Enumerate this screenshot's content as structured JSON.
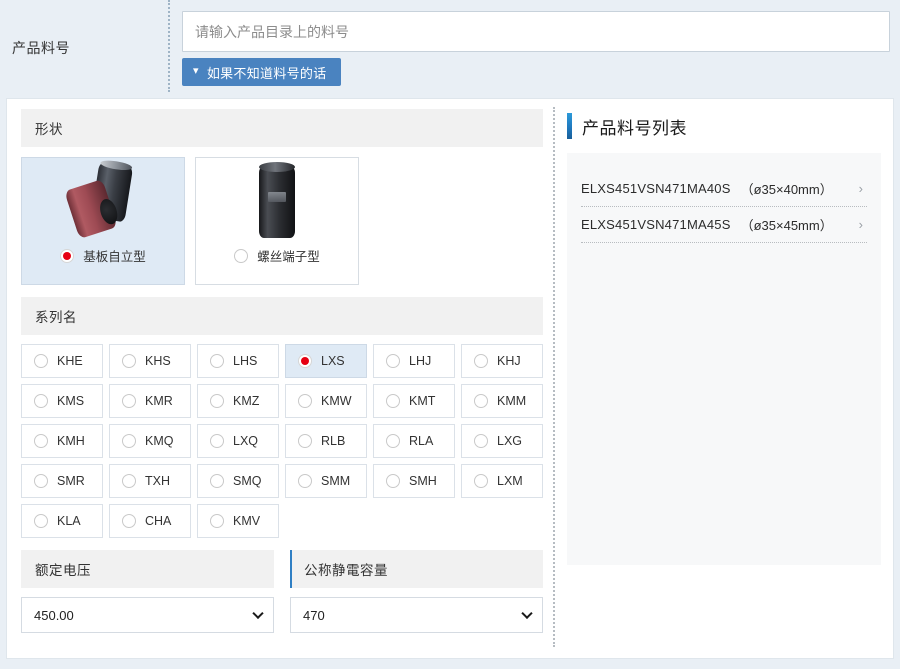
{
  "search": {
    "label": "产品料号",
    "placeholder": "请输入产品目录上的料号",
    "value": "",
    "hint_button": "如果不知道料号的话",
    "hint_chevron": "chevron-down-icon"
  },
  "shape": {
    "header": "形状",
    "options": [
      {
        "label": "基板自立型",
        "selected": true,
        "art": "snap-in-capacitor"
      },
      {
        "label": "螺丝端子型",
        "selected": false,
        "art": "screw-terminal-capacitor"
      }
    ]
  },
  "series": {
    "header": "系列名",
    "options": [
      {
        "label": "KHE",
        "selected": false
      },
      {
        "label": "KHS",
        "selected": false
      },
      {
        "label": "LHS",
        "selected": false
      },
      {
        "label": "LXS",
        "selected": true
      },
      {
        "label": "LHJ",
        "selected": false
      },
      {
        "label": "KHJ",
        "selected": false
      },
      {
        "label": "KMS",
        "selected": false
      },
      {
        "label": "KMR",
        "selected": false
      },
      {
        "label": "KMZ",
        "selected": false
      },
      {
        "label": "KMW",
        "selected": false
      },
      {
        "label": "KMT",
        "selected": false
      },
      {
        "label": "KMM",
        "selected": false
      },
      {
        "label": "KMH",
        "selected": false
      },
      {
        "label": "KMQ",
        "selected": false
      },
      {
        "label": "LXQ",
        "selected": false
      },
      {
        "label": "RLB",
        "selected": false
      },
      {
        "label": "RLA",
        "selected": false
      },
      {
        "label": "LXG",
        "selected": false
      },
      {
        "label": "SMR",
        "selected": false
      },
      {
        "label": "TXH",
        "selected": false
      },
      {
        "label": "SMQ",
        "selected": false
      },
      {
        "label": "SMM",
        "selected": false
      },
      {
        "label": "SMH",
        "selected": false
      },
      {
        "label": "LXM",
        "selected": false
      },
      {
        "label": "KLA",
        "selected": false
      },
      {
        "label": "CHA",
        "selected": false
      },
      {
        "label": "KMV",
        "selected": false
      }
    ]
  },
  "voltage": {
    "header": "额定电压",
    "value": "450.00"
  },
  "capacitance": {
    "header": "公称静電容量",
    "value": "470"
  },
  "results": {
    "title": "产品料号列表",
    "items": [
      {
        "part_number": "ELXS451VSN471MA40S",
        "dimensions": "（ø35×40mm）",
        "arrow": "chevron-right-icon"
      },
      {
        "part_number": "ELXS451VSN471MA45S",
        "dimensions": "（ø35×45mm）",
        "arrow": "chevron-right-icon"
      }
    ]
  },
  "colors": {
    "page_background": "#e9eff5",
    "accent_blue": "#2f7fc4",
    "button_blue": "#4a83c0",
    "selected_item_background": "#dfeaf5",
    "radio_selected": "#e60012",
    "section_header_background": "#f1f1f1"
  }
}
